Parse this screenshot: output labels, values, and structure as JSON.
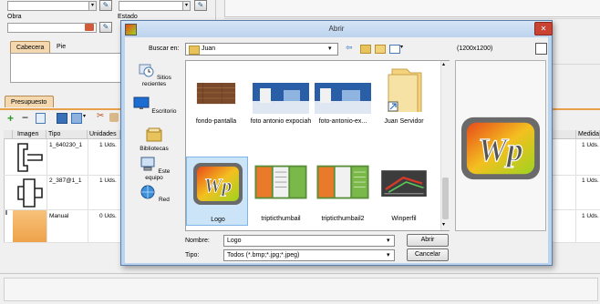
{
  "background_window": {
    "fields": {
      "obra_label": "Obra",
      "estado_label": "Estado"
    },
    "tabs": {
      "cabecera": "Cabecera",
      "pie": "Pie",
      "presupuesto": "Presupuesto"
    },
    "grid": {
      "headers": {
        "imagen": "Imagen",
        "tipo": "Tipo",
        "unidades": "Unidades",
        "medida": "Medida"
      },
      "rows": [
        {
          "tipo": "1_640230_1",
          "unidades": "1 Uds.",
          "medida": "1 Uds."
        },
        {
          "tipo": "2_387@1_1",
          "unidades": "1 Uds.",
          "medida": "1 Uds."
        },
        {
          "tipo": "Manual",
          "unidades": "0 Uds.",
          "medida": "1 Uds."
        }
      ]
    }
  },
  "dialog": {
    "title": "Abrir",
    "close_glyph": "✕",
    "buscar_en_label": "Buscar en:",
    "current_folder": "Juan",
    "preview_size": "(1200x1200)",
    "places": [
      {
        "label": "Sitios recientes",
        "icon": "recent-places-icon"
      },
      {
        "label": "Escritorio",
        "icon": "desktop-icon"
      },
      {
        "label": "Bibliotecas",
        "icon": "libraries-icon"
      },
      {
        "label": "Este equipo",
        "icon": "computer-icon"
      },
      {
        "label": "Red",
        "icon": "network-icon"
      }
    ],
    "files": [
      {
        "label": "fondo-pantalla",
        "icon": "image-wood-thumbnail"
      },
      {
        "label": "foto antonio expociah",
        "icon": "image-photo-thumbnail"
      },
      {
        "label": "foto-antonio-ex...",
        "icon": "image-photo-thumbnail"
      },
      {
        "label": "Juan Servidor",
        "icon": "folder-shortcut-icon"
      },
      {
        "label": "Logo",
        "icon": "image-logo-thumbnail"
      },
      {
        "label": "tripticthumbail",
        "icon": "image-triptic-thumbnail"
      },
      {
        "label": "tripticthumbail2",
        "icon": "image-triptic-thumbnail"
      },
      {
        "label": "Winperfil",
        "icon": "image-3d-thumbnail"
      }
    ],
    "logo_text": "Wp",
    "nombre_label": "Nombre:",
    "nombre_value": "Logo",
    "tipo_label": "Tipo:",
    "tipo_value": "Todos (*.bmp;*.jpg;*.jpeg)",
    "abrir_button": "Abrir",
    "cancelar_button": "Cancelar",
    "colors": {
      "title_bar": "#bcd3ee",
      "close_button": "#c94232",
      "selection": "#cce4f7",
      "logo_gradient_start": "#e84a1a",
      "logo_gradient_end": "#9ed320"
    }
  }
}
